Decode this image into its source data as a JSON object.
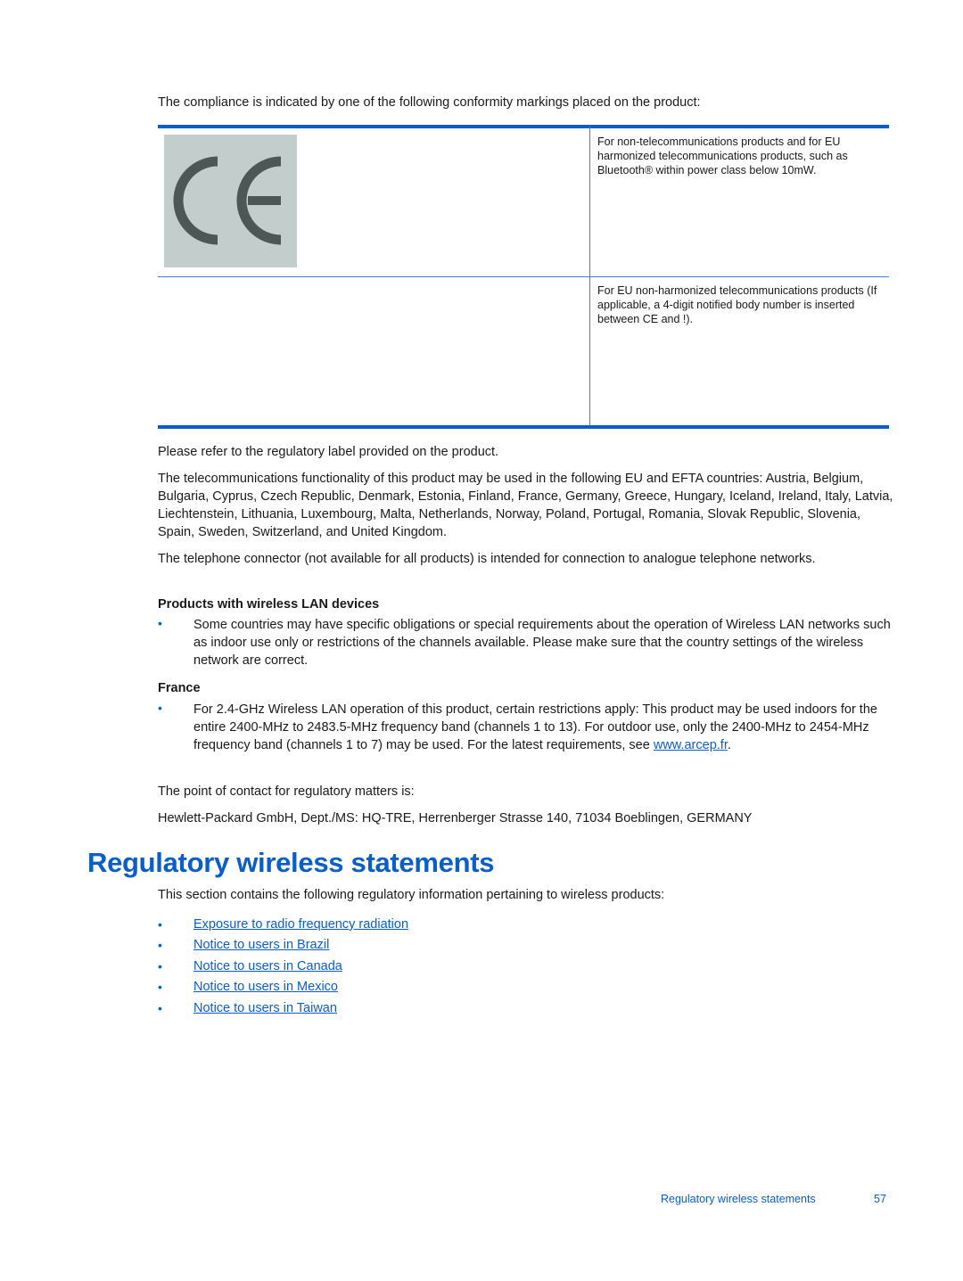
{
  "intro": "The compliance is indicated by one of the following conformity markings placed on the product:",
  "markings_table": {
    "rows": [
      {
        "mark": "CE",
        "mark_icon": "ce-mark-icon",
        "description": "For non-telecommunications products and for EU harmonized telecommunications products, such as Bluetooth® within power class below 10mW."
      },
      {
        "mark": "",
        "description": "For EU non-harmonized telecommunications products (If applicable, a 4-digit notified body number is inserted between CE and !)."
      }
    ]
  },
  "refer_label": "Please refer to the regulatory label provided on the product.",
  "countries_text": "The telecommunications functionality of this product may be used in the following EU and EFTA countries: Austria, Belgium, Bulgaria, Cyprus, Czech Republic, Denmark, Estonia, Finland, France, Germany, Greece, Hungary, Iceland, Ireland, Italy, Latvia, Liechtenstein, Lithuania, Luxembourg, Malta, Netherlands, Norway, Poland, Portugal, Romania, Slovak Republic, Slovenia, Spain, Sweden, Switzerland, and United Kingdom.",
  "telephone_text": "The telephone connector (not available for all products) is intended for connection to analogue telephone networks.",
  "wireless_lan": {
    "heading": "Products with wireless LAN devices",
    "bullet": "Some countries may have specific obligations or special requirements about the operation of Wireless LAN networks such as indoor use only or restrictions of the channels available. Please make sure that the country settings of the wireless network are correct."
  },
  "france": {
    "heading": "France",
    "bullet_prefix": "For 2.4-GHz Wireless LAN operation of this product, certain restrictions apply: This product may be used indoors for the entire 2400-MHz to 2483.5-MHz frequency band (channels 1 to 13). For outdoor use, only the 2400-MHz to 2454-MHz frequency band (channels 1 to 7) may be used. For the latest requirements, see ",
    "link_text": "www.arcep.fr",
    "bullet_suffix": "."
  },
  "contact": {
    "label": "The point of contact for regulatory matters is:",
    "address": "Hewlett-Packard GmbH, Dept./MS: HQ-TRE, Herrenberger Strasse 140, 71034 Boeblingen, GERMANY"
  },
  "section": {
    "title": "Regulatory wireless statements",
    "intro": "This section contains the following regulatory information pertaining to wireless products:",
    "links": [
      "Exposure to radio frequency radiation",
      "Notice to users in Brazil",
      "Notice to users in Canada",
      "Notice to users in Mexico",
      "Notice to users in Taiwan"
    ]
  },
  "footer": {
    "title": "Regulatory wireless statements",
    "page_number": "57"
  },
  "colors": {
    "accent": "#0a5ec9",
    "ce_background": "#c3cdcb",
    "ce_glyph": "#4d5756"
  }
}
